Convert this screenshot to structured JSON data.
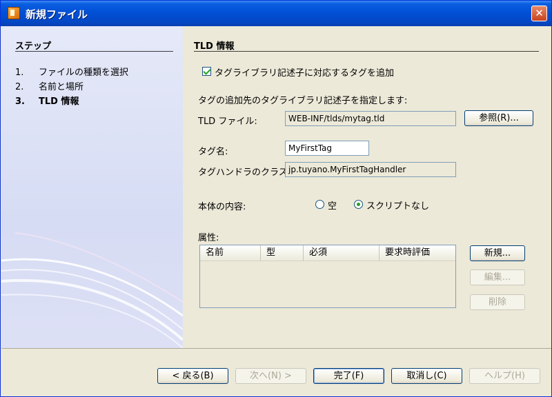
{
  "window": {
    "title": "新規ファイル",
    "close_glyph": "✕"
  },
  "steps": {
    "heading": "ステップ",
    "items": [
      {
        "num": "1.",
        "label": "ファイルの種類を選択"
      },
      {
        "num": "2.",
        "label": "名前と場所"
      },
      {
        "num": "3.",
        "label": "TLD 情報"
      }
    ]
  },
  "form": {
    "heading": "TLD 情報",
    "add_tag_checkbox": {
      "label": "タグライブラリ記述子に対応するタグを追加",
      "checked": true
    },
    "instruction": "タグの追加先のタグライブラリ記述子を指定します:",
    "tld_file": {
      "label": "TLD ファイル:",
      "value": "WEB-INF/tlds/mytag.tld"
    },
    "browse_button": "参照(R)...",
    "tag_name": {
      "label": "タグ名:",
      "value": "MyFirstTag"
    },
    "handler_class": {
      "label": "タグハンドラのクラス:",
      "value": "jp.tuyano.MyFirstTagHandler"
    },
    "body_content": {
      "label": "本体の内容:",
      "options": [
        {
          "label": "空",
          "checked": false
        },
        {
          "label": "スクリプトなし",
          "checked": true
        }
      ]
    },
    "attributes": {
      "label": "属性:",
      "columns": [
        "名前",
        "型",
        "必須",
        "要求時評価"
      ],
      "rows": []
    },
    "new_button": "新規...",
    "edit_button": "編集...",
    "delete_button": "削除"
  },
  "footer": {
    "back": "< 戻る(B)",
    "next": "次へ(N) >",
    "finish": "完了(F)",
    "cancel": "取消し(C)",
    "help": "ヘルプ(H)"
  }
}
